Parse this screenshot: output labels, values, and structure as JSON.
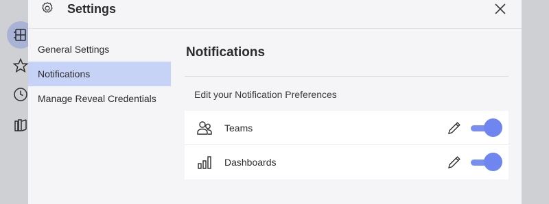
{
  "background_rail": {
    "icons": [
      "dashboard-grid-icon",
      "star-icon",
      "clock-icon",
      "library-icon"
    ]
  },
  "dialog": {
    "title": "Settings",
    "icon": "gear-icon",
    "close_icon": "close-icon"
  },
  "nav": {
    "items": [
      {
        "label": "General Settings",
        "active": false
      },
      {
        "label": "Notifications",
        "active": true
      },
      {
        "label": "Manage Reveal Credentials",
        "active": false
      }
    ]
  },
  "content": {
    "title": "Notifications",
    "subtitle": "Edit your Notification Preferences",
    "preferences": [
      {
        "label": "Teams",
        "icon": "users-icon",
        "enabled": true
      },
      {
        "label": "Dashboards",
        "icon": "bar-chart-icon",
        "enabled": true
      }
    ]
  },
  "colors": {
    "accent": "#6f85f0",
    "nav_active_bg": "#c7d3f6",
    "overlay_bg": "#cfd0d4"
  }
}
